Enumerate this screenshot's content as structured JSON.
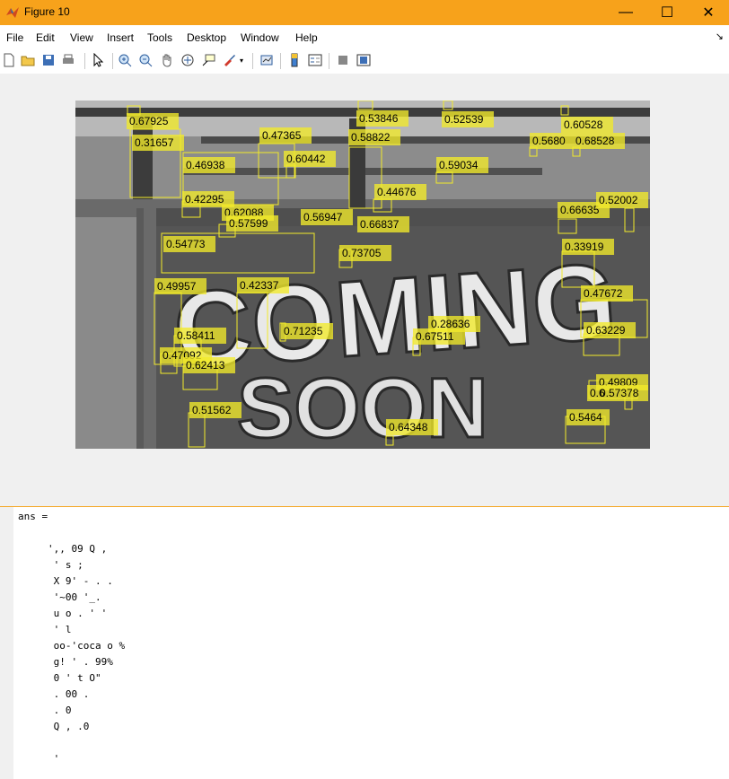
{
  "window": {
    "title": "Figure 10",
    "minimize": "—",
    "maximize": "☐",
    "close": "✕"
  },
  "menu": [
    "File",
    "Edit",
    "View",
    "Insert",
    "Tools",
    "Desktop",
    "Window",
    "Help"
  ],
  "menu_dock": "↘",
  "toolbar_icons": [
    "new-figure-icon",
    "open-file-icon",
    "save-icon",
    "print-icon",
    "edit-plot-icon",
    "zoom-in-icon",
    "zoom-out-icon",
    "pan-icon",
    "rotate-3d-icon",
    "data-cursor-icon",
    "brush-icon",
    "dropdown-arrow-icon",
    "link-plot-icon",
    "insert-colorbar-icon",
    "insert-legend-icon",
    "hide-plot-tools-icon",
    "show-plot-tools-icon"
  ],
  "detections": [
    "0.67925",
    "0.31657",
    "0.46938",
    "0.42295",
    "0.47365",
    "0.60442",
    "0.53846",
    "0.58822",
    "0.52539",
    "0.60528",
    "0.5680",
    "0.68528",
    "0.59034",
    "0.44676",
    "0.62088",
    "0.57599",
    "0.56947",
    "0.66837",
    "0.66635",
    "0.52002",
    "0.54773",
    "0.73705",
    "0.33919",
    "0.49957",
    "0.42337",
    "0.47672",
    "0.28636",
    "0.67511",
    "0.63229",
    "0.71235",
    "0.58411",
    "0.47092",
    "0.62413",
    "0.49809",
    "0.57378",
    "0.51562",
    "0.5464",
    "0.64348",
    "0.6"
  ],
  "graffiti_text": [
    "COMING",
    "SOON"
  ],
  "console": {
    "ans_line": "ans =",
    "lines": [
      "',, 09 Q ,",
      " ' s ;",
      " X 9' - . .",
      " '~00 '_.",
      " u o . ' '",
      " ' l",
      " oo-'coca o %",
      " g! ' . 99%",
      " 0 ' t O\"",
      " . 00 .",
      " . 0",
      " Q , .0",
      "",
      "",
      " '"
    ]
  },
  "colors": {
    "title_bar": "#f7a21b",
    "detection_box": "#f2ea2a"
  }
}
